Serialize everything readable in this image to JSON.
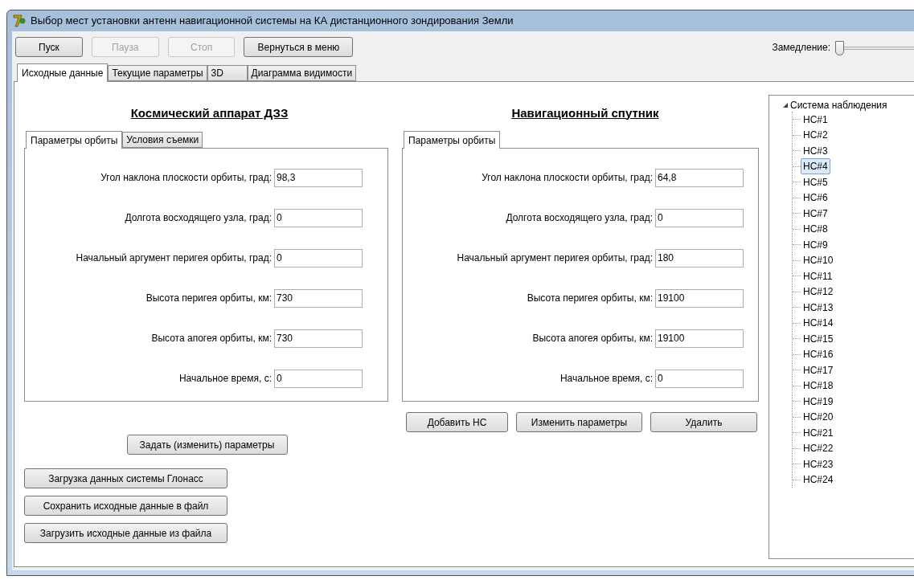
{
  "window": {
    "title": "Выбор мест установки антенн навигационной системы на КА дистанционного зондирования Земли"
  },
  "toolbar": {
    "buttons": [
      {
        "label": "Пуск",
        "disabled": false
      },
      {
        "label": "Пауза",
        "disabled": true
      },
      {
        "label": "Стоп",
        "disabled": true
      },
      {
        "label": "Вернуться в меню",
        "disabled": false
      }
    ],
    "slowdown": {
      "label": "Замедление:",
      "level": 0
    }
  },
  "tabs": [
    {
      "label": "Исходные данные",
      "selected": true
    },
    {
      "label": "Текущие параметры",
      "selected": false
    },
    {
      "label": "3D",
      "selected": false
    },
    {
      "label": "Диаграмма видимости",
      "selected": false
    }
  ],
  "spacecraft": {
    "heading": "Космический аппарат ДЗЗ",
    "tabs": [
      {
        "label": "Параметры орбиты",
        "selected": true
      },
      {
        "label": "Условия съемки",
        "selected": false
      }
    ],
    "fields": [
      {
        "label": "Угол наклона плоскости орбиты, град:",
        "value": "98,3"
      },
      {
        "label": "Долгота восходящего узла, град:",
        "value": "0"
      },
      {
        "label": "Начальный аргумент перигея орбиты, град:",
        "value": "0"
      },
      {
        "label": "Высота перигея орбиты, км:",
        "value": "730"
      },
      {
        "label": "Высота апогея орбиты, км:",
        "value": "730"
      },
      {
        "label": "Начальное время, с:",
        "value": "0"
      }
    ],
    "buttons": [
      "Задать (изменить) параметры"
    ]
  },
  "satellite": {
    "heading": "Навигационный спутник",
    "tabs": [
      {
        "label": "Параметры орбиты",
        "selected": true
      }
    ],
    "fields": [
      {
        "label": "Угол наклона плоскости орбиты, град:",
        "value": "64,8"
      },
      {
        "label": "Долгота восходящего узла, град:",
        "value": "0"
      },
      {
        "label": "Начальный аргумент перигея орбиты, град:",
        "value": "180"
      },
      {
        "label": "Высота перигея орбиты, км:",
        "value": "19100"
      },
      {
        "label": "Высота апогея орбиты, км:",
        "value": "19100"
      },
      {
        "label": "Начальное время, с:",
        "value": "0"
      }
    ],
    "buttons": [
      "Добавить НС",
      "Изменить параметры",
      "Удалить"
    ]
  },
  "file_buttons": [
    "Загрузка данных системы Глонасс",
    "Сохранить исходные данные в файл",
    "Загрузить исходные данные из файла"
  ],
  "tree": {
    "label": "Система наблюдения",
    "expanded": true,
    "children": [
      {
        "label": "НС#1",
        "selected": false
      },
      {
        "label": "НС#2",
        "selected": false
      },
      {
        "label": "НС#3",
        "selected": false
      },
      {
        "label": "НС#4",
        "selected": true
      },
      {
        "label": "НС#5",
        "selected": false
      },
      {
        "label": "НС#6",
        "selected": false
      },
      {
        "label": "НС#7",
        "selected": false
      },
      {
        "label": "НС#8",
        "selected": false
      },
      {
        "label": "НС#9",
        "selected": false
      },
      {
        "label": "НС#10",
        "selected": false
      },
      {
        "label": "НС#11",
        "selected": false
      },
      {
        "label": "НС#12",
        "selected": false
      },
      {
        "label": "НС#13",
        "selected": false
      },
      {
        "label": "НС#14",
        "selected": false
      },
      {
        "label": "НС#15",
        "selected": false
      },
      {
        "label": "НС#16",
        "selected": false
      },
      {
        "label": "НС#17",
        "selected": false
      },
      {
        "label": "НС#18",
        "selected": false
      },
      {
        "label": "НС#19",
        "selected": false
      },
      {
        "label": "НС#20",
        "selected": false
      },
      {
        "label": "НС#21",
        "selected": false
      },
      {
        "label": "НС#22",
        "selected": false
      },
      {
        "label": "НС#23",
        "selected": false
      },
      {
        "label": "НС#24",
        "selected": false
      }
    ]
  }
}
